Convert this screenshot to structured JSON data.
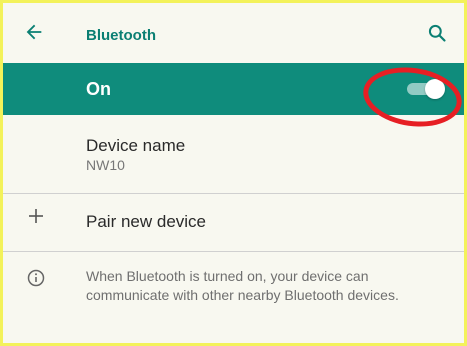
{
  "header": {
    "title": "Bluetooth",
    "back_icon": "arrow-left-icon",
    "search_icon": "search-icon",
    "accent_color": "#0b7f73"
  },
  "bluetooth": {
    "state_label": "On",
    "enabled": true,
    "bar_color": "#0f8c7c"
  },
  "device": {
    "title": "Device name",
    "name": "NW10"
  },
  "pair": {
    "label": "Pair new device",
    "icon": "plus-icon"
  },
  "info": {
    "icon": "info-icon",
    "text": "When Bluetooth is turned on, your device can communicate with other nearby Bluetooth devices."
  },
  "annotation": {
    "highlight_color": "#e61f24"
  }
}
